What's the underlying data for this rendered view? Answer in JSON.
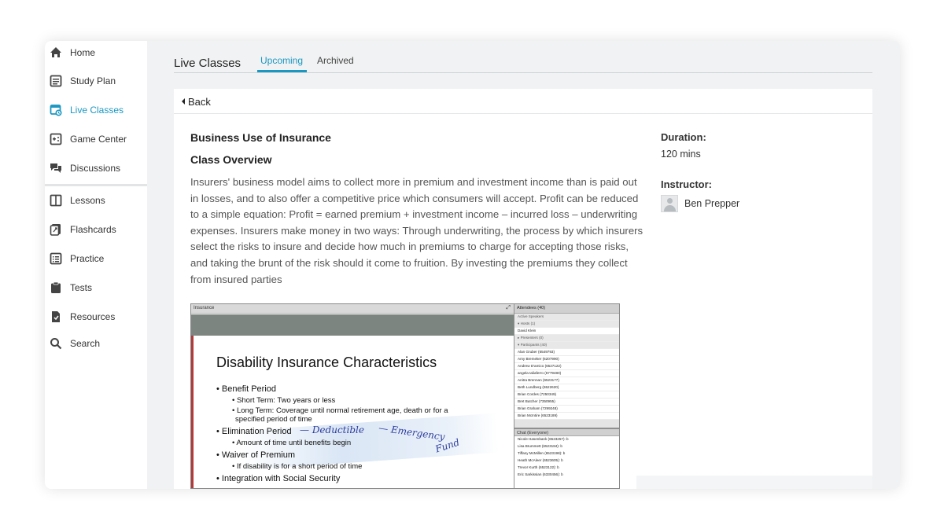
{
  "sidebar": {
    "items": [
      {
        "label": "Home",
        "icon": "home-icon"
      },
      {
        "label": "Study Plan",
        "icon": "study-plan-icon"
      },
      {
        "label": "Live Classes",
        "icon": "live-classes-icon",
        "active": true
      },
      {
        "label": "Game Center",
        "icon": "game-center-icon"
      },
      {
        "label": "Discussions",
        "icon": "discussions-icon"
      },
      {
        "label": "Lessons",
        "icon": "lessons-icon"
      },
      {
        "label": "Flashcards",
        "icon": "flashcards-icon"
      },
      {
        "label": "Practice",
        "icon": "practice-icon"
      },
      {
        "label": "Tests",
        "icon": "tests-icon"
      },
      {
        "label": "Resources",
        "icon": "resources-icon"
      },
      {
        "label": "Search",
        "icon": "search-icon"
      }
    ]
  },
  "header": {
    "title": "Live Classes",
    "tabs": [
      {
        "label": "Upcoming",
        "active": true
      },
      {
        "label": "Archived"
      }
    ]
  },
  "detail": {
    "back_label": "Back",
    "class_title": "Business Use of Insurance",
    "overview_heading": "Class Overview",
    "overview_text": "Insurers' business model aims to collect more in premium and investment income than is paid out in losses, and to also offer a competitive price which consumers will accept. Profit can be reduced to a simple equation: Profit = earned premium + investment income – incurred loss – underwriting expenses. Insurers make money in two ways: Through underwriting, the process by which insurers select the risks to insure and decide how much in premiums to charge for accepting those risks, and taking the brunt of the risk should it come to fruition. By investing the premiums they collect from insured parties",
    "duration_label": "Duration:",
    "duration_value": "120 mins",
    "instructor_label": "Instructor:",
    "instructor_name": "Ben Prepper"
  },
  "recording": {
    "window_title": "Insurance",
    "slide_title": "Disability Insurance Characteristics",
    "slide_lines": [
      "• Benefit Period",
      "• Short Term:  Two years or less",
      "• Long Term:  Coverage until normal retirement age, death or for a",
      "specified period of time",
      "• Elimination Period",
      "• Amount of time until benefits begin",
      "• Waiver of Premium",
      "• If disability is for a short period of time",
      "• Integration with Social Security"
    ],
    "handwriting": [
      "— Deductible",
      "— Emergency",
      "Fund"
    ],
    "attendees_header": "Attendees  (40)",
    "attendee_sections": {
      "active_speakers": "Active Speakers",
      "hosts": "▾  Hosts (1)",
      "host_name": "David Klein",
      "presenters": "▸  Presenters (0)",
      "participants": "▾  Participants (40)"
    },
    "participants": [
      "Alan Gruber (6549793)",
      "Amy Bremeker (6207990)",
      "Andrew D'amico (6527122)",
      "angela taliaferro (6779480)",
      "Anitra Brennan (6523177)",
      "Beth Lundberg (6522620)",
      "Brian Cordes (7250349)",
      "Bret Butcher (7350955)",
      "Brian Graham (7299248)",
      "Brian McIntire (6523189)"
    ],
    "chat_header": "Chat  (Everyone)",
    "chat_rows": [
      "Nicole Hasenbank (6523257): b",
      "Lisa Brummett (6523184): b",
      "Tiffany McMillen (6523198): b",
      "Heath McAleer (6523605): b",
      "Trevor Kurth (6523122): b",
      "Eric Sarkissian (6330456): b"
    ]
  },
  "colors": {
    "accent": "#1b97c1",
    "frame_bg": "#f1f2f3",
    "card_bg": "#ffffff"
  }
}
